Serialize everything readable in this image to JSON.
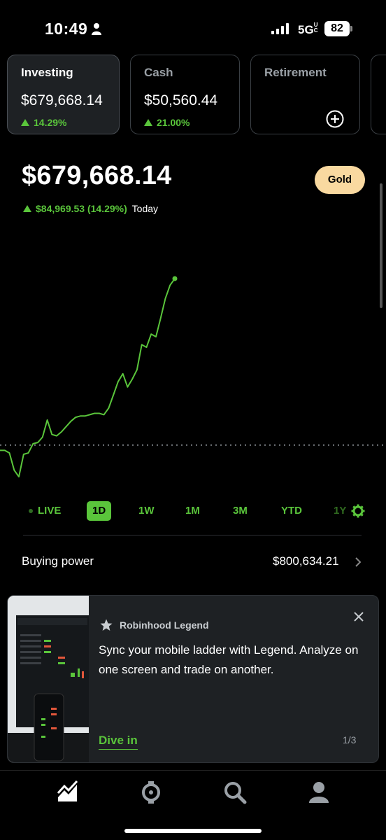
{
  "status_bar": {
    "time": "10:49",
    "network": "5G",
    "network_suffix": "UC",
    "battery": "82"
  },
  "accounts": [
    {
      "label": "Investing",
      "value": "$679,668.14",
      "change": "14.29%",
      "active": true
    },
    {
      "label": "Cash",
      "value": "$50,560.44",
      "change": "21.00%",
      "active": false
    },
    {
      "label": "Retirement",
      "value": "",
      "change": "",
      "active": false,
      "action_icon": "plus-circle-icon"
    }
  ],
  "portfolio": {
    "value": "$679,668.14",
    "badge": "Gold",
    "change": "$84,969.53 (14.29%)",
    "change_period": "Today"
  },
  "chart_data": {
    "type": "line",
    "series_color": "#5ac53b",
    "baseline_style": "dotted",
    "trend": "up",
    "y_relative": [
      0.3,
      0.3,
      0.28,
      0.15,
      0.1,
      0.27,
      0.28,
      0.35,
      0.36,
      0.4,
      0.53,
      0.42,
      0.41,
      0.44,
      0.48,
      0.52,
      0.55,
      0.56,
      0.56,
      0.57,
      0.58,
      0.58,
      0.57,
      0.62,
      0.72,
      0.82,
      0.88,
      0.78,
      0.84,
      0.91,
      1.1,
      1.08,
      1.18,
      1.16,
      1.3,
      1.45,
      1.55,
      1.6
    ],
    "baseline_relative": 0.34
  },
  "ranges": {
    "items": [
      "LIVE",
      "1D",
      "1W",
      "1M",
      "3M",
      "YTD",
      "1Y"
    ],
    "selected": "1D",
    "settings_icon": "gear-icon"
  },
  "buying_power": {
    "label": "Buying power",
    "value": "$800,634.21"
  },
  "promo": {
    "tag": "Robinhood Legend",
    "body": "Sync your mobile ladder with Legend. Analyze on one screen and trade on another.",
    "cta": "Dive in",
    "pager": "1/3"
  },
  "tabbar": {
    "items": [
      "chart-icon",
      "crypto-icon",
      "search-icon",
      "account-icon"
    ]
  },
  "colors": {
    "accent_green": "#5ac53b",
    "gold_badge": "#f9d9a0",
    "background": "#000000"
  }
}
